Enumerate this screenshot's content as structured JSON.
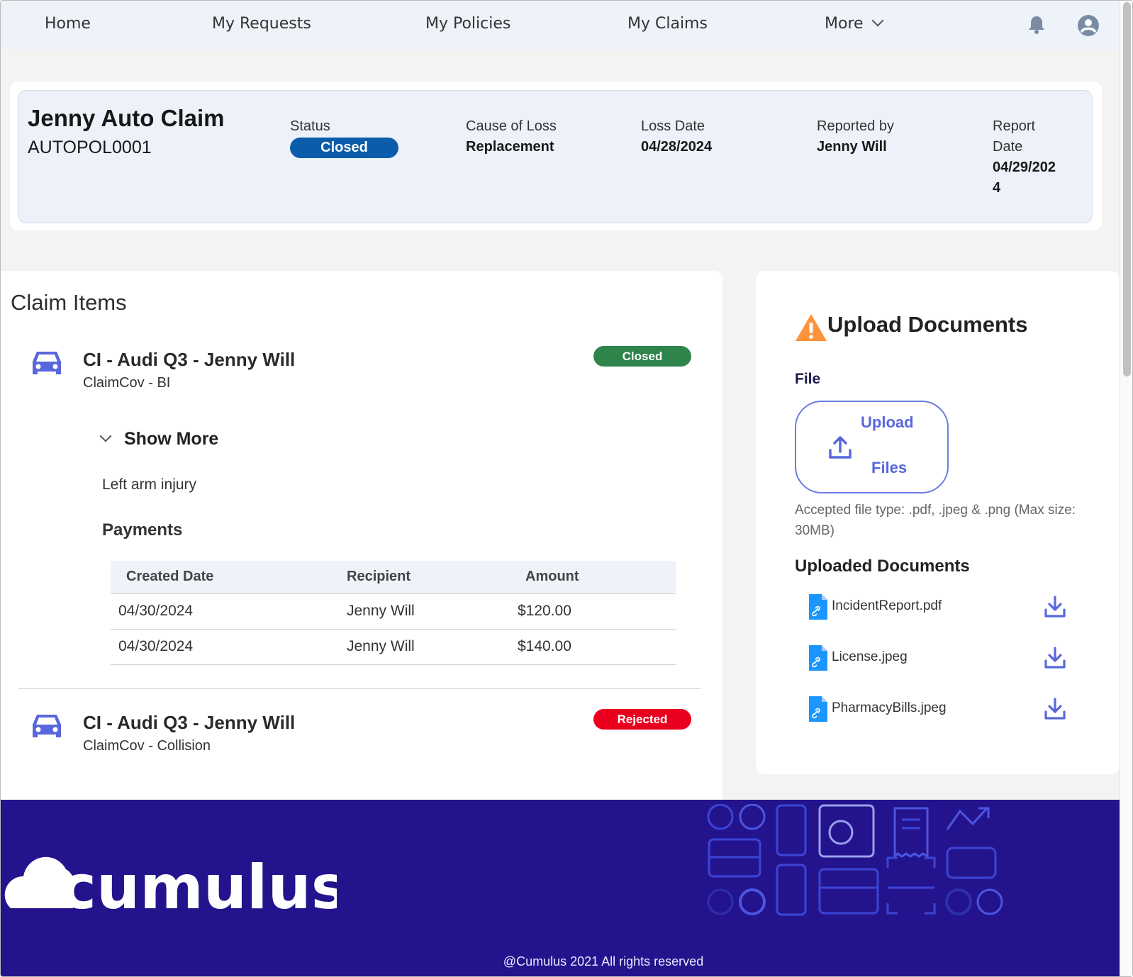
{
  "nav": {
    "items": [
      "Home",
      "My Requests",
      "My Policies",
      "My Claims",
      "More"
    ],
    "bell_icon": "bell-icon",
    "avatar_icon": "user-avatar-icon"
  },
  "claim": {
    "title": "Jenny Auto Claim",
    "number": "AUTOPOL0001",
    "fields": {
      "status_label": "Status",
      "status_value": "Closed",
      "cause_label": "Cause of Loss",
      "cause_value": "Replacement",
      "loss_date_label": "Loss Date",
      "loss_date_value": "04/28/2024",
      "reported_label": "Reported by",
      "reported_value": "Jenny Will",
      "report_date_label": "Report Date",
      "report_date_value": "04/29/2024"
    }
  },
  "items": {
    "heading": "Claim Items",
    "list": [
      {
        "title": "CI - Audi Q3 - Jenny Will",
        "subtitle": "ClaimCov - BI",
        "status": "Closed",
        "show_more": "Show More",
        "description": "Left arm injury",
        "payments_heading": "Payments",
        "payments_columns": [
          "Created Date",
          "Recipient",
          "Amount"
        ],
        "payments": [
          [
            "04/30/2024",
            "Jenny Will",
            "$120.00"
          ],
          [
            "04/30/2024",
            "Jenny Will",
            "$140.00"
          ]
        ]
      },
      {
        "title": "CI - Audi Q3 - Jenny Will",
        "subtitle": "ClaimCov - Collision",
        "status": "Rejected"
      }
    ]
  },
  "upload": {
    "title": "Upload Documents",
    "file_label": "File",
    "button_line1": "Upload",
    "button_line2": "Files",
    "accepted": "Accepted file type: .pdf, .jpeg & .png (Max size: 30MB)",
    "uploaded_heading": "Uploaded Documents",
    "documents": [
      "IncidentReport.pdf",
      "License.jpeg",
      "PharmacyBills.jpeg"
    ]
  },
  "footer": {
    "brand": "cumulus",
    "copyright": "@Cumulus 2021 All rights reserved"
  },
  "colors": {
    "status_closed": "#0b5cab",
    "badge_closed": "#2e844a",
    "badge_rejected": "#ea001e",
    "accent": "#5867dd",
    "footer_bg": "#23148d"
  }
}
